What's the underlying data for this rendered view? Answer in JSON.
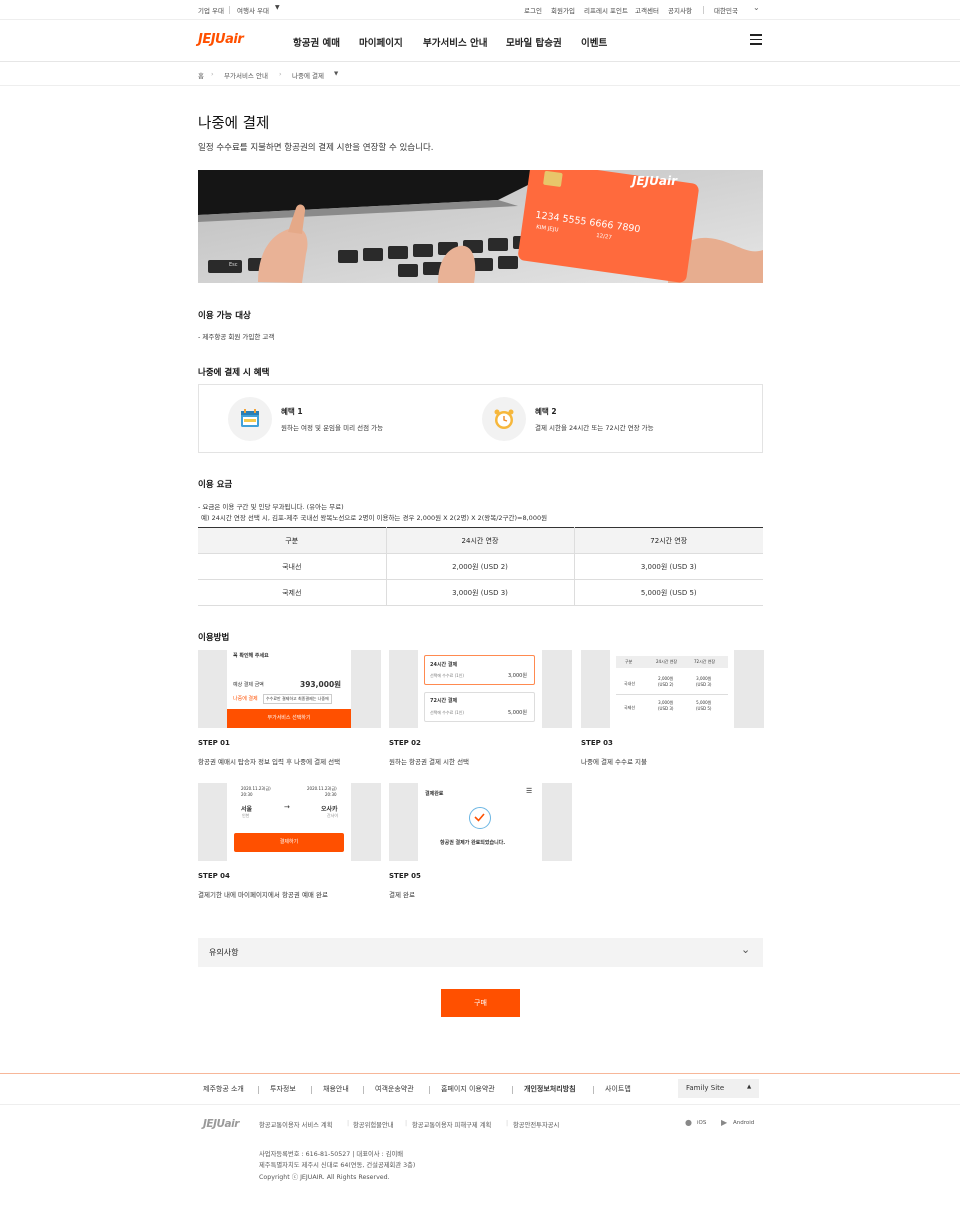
{
  "util": {
    "left": [
      "기업 우대",
      "여행사 우대"
    ],
    "right": [
      "로그인",
      "회원가입",
      "리프레시 포인트",
      "고객센터",
      "공지사항",
      "대한민국"
    ]
  },
  "logo": "JEJUair",
  "gnb": [
    "항공권 예매",
    "마이페이지",
    "부가서비스 안내",
    "모바일 탑승권",
    "이벤트"
  ],
  "breadcrumb": [
    "홈",
    "부가서비스 안내",
    "나중에 결제"
  ],
  "page": {
    "title": "나중에 결제",
    "subtitle": "일정 수수료를 지불하면 항공권의 결제 시한을 연장할 수 있습니다."
  },
  "hero": {
    "card_brand": "JEJUair",
    "card_number": "1234  5555  6666  7890",
    "card_name": "KIM JEJU",
    "card_exp": "12/27",
    "key_label": "Esc"
  },
  "eligible": {
    "heading": "이용 가능 대상",
    "text": "- 제주항공 회원 가입한 고객"
  },
  "benefits": {
    "heading": "나중에 결제 시 혜택",
    "items": [
      {
        "title": "혜택 1",
        "desc": "원하는 여정 및 운임을 미리 선점 가능",
        "icon": "calendar-icon"
      },
      {
        "title": "혜택 2",
        "desc": "결제 시한을 24시간 또는 72시간 연장 가능",
        "icon": "alarm-clock-icon"
      }
    ]
  },
  "fee": {
    "heading": "이용 요금",
    "note1": "- 요금은 이용 구간 및 인당 부과됩니다. (유아는 무료)",
    "note2": "예) 24시간 연장 선택 시, 김포-제주 국내선 왕복노선으로 2명이 이용하는 경우 2,000원 X 2(2명) X 2(왕복/2구간)=8,000원",
    "headers": [
      "구분",
      "24시간 연장",
      "72시간 연장"
    ],
    "rows": [
      [
        "국내선",
        "2,000원 (USD 2)",
        "3,000원 (USD 3)"
      ],
      [
        "국제선",
        "3,000원 (USD 3)",
        "5,000원 (USD 5)"
      ]
    ]
  },
  "howto": {
    "heading": "이용방법",
    "steps": [
      {
        "label": "STEP 01",
        "desc": "항공권 예매시 탑승자 정보 입력 후 나중에 결제 선택"
      },
      {
        "label": "STEP 02",
        "desc": "원하는 항공권 결제 시한 선택"
      },
      {
        "label": "STEP 03",
        "desc": "나중에 결제 수수료 지불"
      },
      {
        "label": "STEP 04",
        "desc": "결제기한 내에 마이페이지에서 항공권 예매 완료"
      },
      {
        "label": "STEP 05",
        "desc": "결제 완료"
      }
    ],
    "s1": {
      "top": "꼭 확인해 주세요",
      "amount_label": "예상 결제 금액",
      "amount": "393,000원",
      "later": "나중에 결제",
      "later_note": "수수료만 결제하고 최종결제는 나중에",
      "button": "부가서비스 선택하기"
    },
    "s2": {
      "o1_title": "24시간 결제",
      "o1_label": "선택에 수수료 (1인)",
      "o1_price": "3,000원",
      "o2_title": "72시간 결제",
      "o2_label": "선택에 수수료 (1인)",
      "o2_price": "5,000원"
    },
    "s3": {
      "h": [
        "구분",
        "24시간 연장",
        "72시간 연장"
      ],
      "r1": [
        "국내선",
        "2,000원\n(USD 2)",
        "3,000원\n(USD 3)"
      ],
      "r2": [
        "국제선",
        "3,000원\n(USD 3)",
        "5,000원\n(USD 5)"
      ]
    },
    "s4": {
      "date1": "2020.11.23(금)",
      "time1": "20:30",
      "date2": "2020.11.23(금)",
      "time2": "20:30",
      "from": "서울",
      "from_code": "인천",
      "to": "오사카",
      "to_code": "간사이",
      "button": "결제하기"
    },
    "s5": {
      "header": "결제완료",
      "message": "항공권 결제가 완료되었습니다."
    }
  },
  "notice": {
    "label": "유의사항"
  },
  "buy": {
    "label": "구매"
  },
  "footer": {
    "links": [
      "제주항공 소개",
      "투자정보",
      "채용안내",
      "여객운송약관",
      "홈페이지 이용약관",
      "개인정보처리방침",
      "사이트맵"
    ],
    "family": "Family Site",
    "links2": [
      "항공교통이용자 서비스 계획",
      "항공위험물안내",
      "항공교통이용자 피해구제 계획",
      "항공안전투자공시"
    ],
    "apps": [
      "iOS",
      "Android"
    ],
    "biz": "사업자등록번호 : 616-81-50527  |  대표이사 : 김이배",
    "addr": "제주특별자치도 제주시 신대로 64(연동, 건설공제회관 3층)",
    "copyright": "Copyright ⓒ JEJUAIR. All Rights Reserved."
  },
  "colors": {
    "brand": "#ff5000"
  }
}
